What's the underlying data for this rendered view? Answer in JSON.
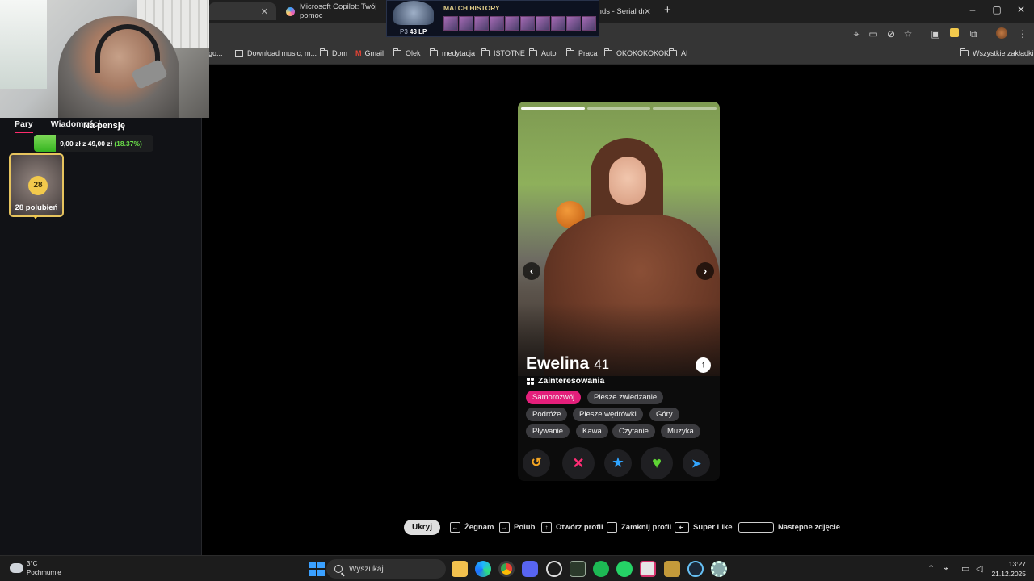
{
  "browser": {
    "tabs": [
      {
        "label": "",
        "active": true
      },
      {
        "label": "Microsoft Copilot: Twój pomoc"
      },
      {
        "label": "Odcinki Friends - Serial dramat"
      }
    ],
    "window_controls": [
      "–",
      "▢",
      "✕"
    ],
    "bookmarks": [
      "go...",
      "Download music, m...",
      "Dom",
      "Gmail",
      "Olek",
      "medytacja",
      "ISTOTNE",
      "Auto",
      "Praca",
      "OKOKOKOKOK",
      "AI",
      "Wszystkie zakładki"
    ]
  },
  "match_history": {
    "title": "MATCH HISTORY",
    "lp_tag": "P3",
    "lp_value": "43 LP"
  },
  "left_panel": {
    "tabs": [
      "Pary",
      "Wiadomości"
    ],
    "overlay_title": "Na pensję",
    "goal": {
      "current": "9,00 zł",
      "sep": "z",
      "target": "49,00 zł",
      "percent": "(18.37%)",
      "progress": 0.1837
    },
    "likes": {
      "count": "28",
      "label": "28 polubień"
    }
  },
  "profile": {
    "name": "Ewelina",
    "age": "41",
    "interests_label": "Zainteresowania",
    "photo_count": 3,
    "interests": [
      {
        "label": "Samorozwój",
        "highlight": true
      },
      {
        "label": "Piesze zwiedzanie"
      },
      {
        "label": "Podróże"
      },
      {
        "label": "Piesze wędrówki"
      },
      {
        "label": "Góry"
      },
      {
        "label": "Pływanie"
      },
      {
        "label": "Kawa"
      },
      {
        "label": "Czytanie"
      },
      {
        "label": "Muzyka"
      }
    ]
  },
  "actions": {
    "rewind": "↺",
    "nope": "✕",
    "super_like": "★",
    "like": "♥",
    "boost": "➤"
  },
  "shortcuts": {
    "hide": "Ukryj",
    "items": [
      "Żegnam",
      "Polub",
      "Otwórz profil",
      "Zamknij profil",
      "Super Like",
      "Następne zdjęcie"
    ]
  },
  "taskbar": {
    "weather_temp": "3°C",
    "weather_desc": "Pochmurnie",
    "search_placeholder": "Wyszukaj",
    "time": "13:27",
    "date": "21.12.2025"
  },
  "colors": {
    "accent": "#fd2b6c",
    "chip_highlight": "#e41f7b",
    "like": "#5ed334",
    "nope": "#ff2d75",
    "super_like": "#2fa4ff",
    "rewind": "#f5a623",
    "boost": "#33a6ff",
    "gold": "#f2c94c"
  }
}
